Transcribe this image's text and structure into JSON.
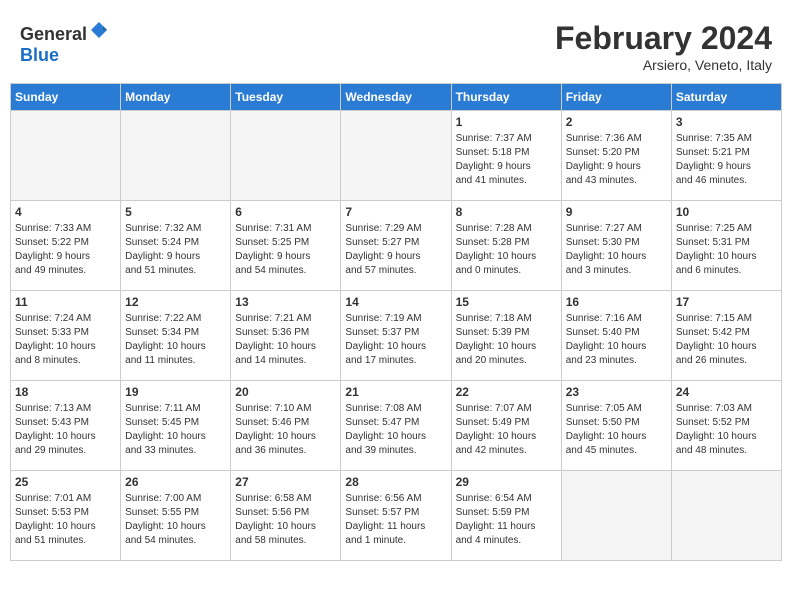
{
  "header": {
    "logo_general": "General",
    "logo_blue": "Blue",
    "month_title": "February 2024",
    "location": "Arsiero, Veneto, Italy"
  },
  "weekdays": [
    "Sunday",
    "Monday",
    "Tuesday",
    "Wednesday",
    "Thursday",
    "Friday",
    "Saturday"
  ],
  "weeks": [
    [
      {
        "day": "",
        "info": ""
      },
      {
        "day": "",
        "info": ""
      },
      {
        "day": "",
        "info": ""
      },
      {
        "day": "",
        "info": ""
      },
      {
        "day": "1",
        "info": "Sunrise: 7:37 AM\nSunset: 5:18 PM\nDaylight: 9 hours\nand 41 minutes."
      },
      {
        "day": "2",
        "info": "Sunrise: 7:36 AM\nSunset: 5:20 PM\nDaylight: 9 hours\nand 43 minutes."
      },
      {
        "day": "3",
        "info": "Sunrise: 7:35 AM\nSunset: 5:21 PM\nDaylight: 9 hours\nand 46 minutes."
      }
    ],
    [
      {
        "day": "4",
        "info": "Sunrise: 7:33 AM\nSunset: 5:22 PM\nDaylight: 9 hours\nand 49 minutes."
      },
      {
        "day": "5",
        "info": "Sunrise: 7:32 AM\nSunset: 5:24 PM\nDaylight: 9 hours\nand 51 minutes."
      },
      {
        "day": "6",
        "info": "Sunrise: 7:31 AM\nSunset: 5:25 PM\nDaylight: 9 hours\nand 54 minutes."
      },
      {
        "day": "7",
        "info": "Sunrise: 7:29 AM\nSunset: 5:27 PM\nDaylight: 9 hours\nand 57 minutes."
      },
      {
        "day": "8",
        "info": "Sunrise: 7:28 AM\nSunset: 5:28 PM\nDaylight: 10 hours\nand 0 minutes."
      },
      {
        "day": "9",
        "info": "Sunrise: 7:27 AM\nSunset: 5:30 PM\nDaylight: 10 hours\nand 3 minutes."
      },
      {
        "day": "10",
        "info": "Sunrise: 7:25 AM\nSunset: 5:31 PM\nDaylight: 10 hours\nand 6 minutes."
      }
    ],
    [
      {
        "day": "11",
        "info": "Sunrise: 7:24 AM\nSunset: 5:33 PM\nDaylight: 10 hours\nand 8 minutes."
      },
      {
        "day": "12",
        "info": "Sunrise: 7:22 AM\nSunset: 5:34 PM\nDaylight: 10 hours\nand 11 minutes."
      },
      {
        "day": "13",
        "info": "Sunrise: 7:21 AM\nSunset: 5:36 PM\nDaylight: 10 hours\nand 14 minutes."
      },
      {
        "day": "14",
        "info": "Sunrise: 7:19 AM\nSunset: 5:37 PM\nDaylight: 10 hours\nand 17 minutes."
      },
      {
        "day": "15",
        "info": "Sunrise: 7:18 AM\nSunset: 5:39 PM\nDaylight: 10 hours\nand 20 minutes."
      },
      {
        "day": "16",
        "info": "Sunrise: 7:16 AM\nSunset: 5:40 PM\nDaylight: 10 hours\nand 23 minutes."
      },
      {
        "day": "17",
        "info": "Sunrise: 7:15 AM\nSunset: 5:42 PM\nDaylight: 10 hours\nand 26 minutes."
      }
    ],
    [
      {
        "day": "18",
        "info": "Sunrise: 7:13 AM\nSunset: 5:43 PM\nDaylight: 10 hours\nand 29 minutes."
      },
      {
        "day": "19",
        "info": "Sunrise: 7:11 AM\nSunset: 5:45 PM\nDaylight: 10 hours\nand 33 minutes."
      },
      {
        "day": "20",
        "info": "Sunrise: 7:10 AM\nSunset: 5:46 PM\nDaylight: 10 hours\nand 36 minutes."
      },
      {
        "day": "21",
        "info": "Sunrise: 7:08 AM\nSunset: 5:47 PM\nDaylight: 10 hours\nand 39 minutes."
      },
      {
        "day": "22",
        "info": "Sunrise: 7:07 AM\nSunset: 5:49 PM\nDaylight: 10 hours\nand 42 minutes."
      },
      {
        "day": "23",
        "info": "Sunrise: 7:05 AM\nSunset: 5:50 PM\nDaylight: 10 hours\nand 45 minutes."
      },
      {
        "day": "24",
        "info": "Sunrise: 7:03 AM\nSunset: 5:52 PM\nDaylight: 10 hours\nand 48 minutes."
      }
    ],
    [
      {
        "day": "25",
        "info": "Sunrise: 7:01 AM\nSunset: 5:53 PM\nDaylight: 10 hours\nand 51 minutes."
      },
      {
        "day": "26",
        "info": "Sunrise: 7:00 AM\nSunset: 5:55 PM\nDaylight: 10 hours\nand 54 minutes."
      },
      {
        "day": "27",
        "info": "Sunrise: 6:58 AM\nSunset: 5:56 PM\nDaylight: 10 hours\nand 58 minutes."
      },
      {
        "day": "28",
        "info": "Sunrise: 6:56 AM\nSunset: 5:57 PM\nDaylight: 11 hours\nand 1 minute."
      },
      {
        "day": "29",
        "info": "Sunrise: 6:54 AM\nSunset: 5:59 PM\nDaylight: 11 hours\nand 4 minutes."
      },
      {
        "day": "",
        "info": ""
      },
      {
        "day": "",
        "info": ""
      }
    ]
  ]
}
